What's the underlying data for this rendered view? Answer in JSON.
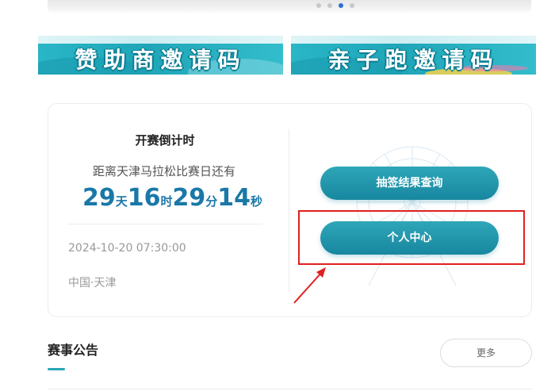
{
  "carousel": {
    "dot_count": 4,
    "active_index": 2
  },
  "banners": [
    {
      "label": "赞助商邀请码"
    },
    {
      "label": "亲子跑邀请码"
    }
  ],
  "countdown": {
    "title": "开赛倒计时",
    "subtitle": "距离天津马拉松比赛日还有",
    "days": "29",
    "days_unit": "天",
    "hours": "16",
    "hours_unit": "时",
    "minutes": "29",
    "minutes_unit": "分",
    "seconds": "14",
    "seconds_unit": "秒",
    "datetime": "2024-10-20 07:30:00",
    "location": "中国·天津"
  },
  "actions": {
    "draw_result": "抽签结果查询",
    "personal_center": "个人中心"
  },
  "notice": {
    "title": "赛事公告",
    "more": "更多"
  },
  "colors": {
    "accent": "#1a78a8",
    "button": "#17879f",
    "highlight": "#e02020",
    "carousel_active": "#2b6fd6"
  }
}
